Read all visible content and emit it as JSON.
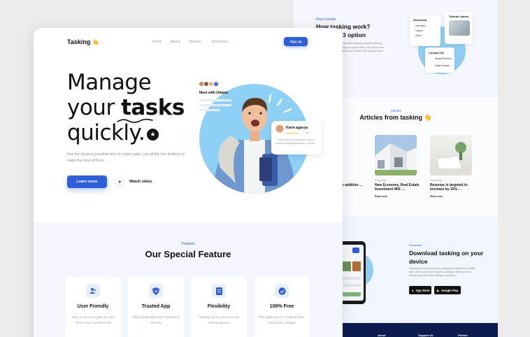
{
  "back_page": {
    "how": {
      "kicker": "How it works",
      "title_line1": "How tasking work?",
      "title_line2": "3 option",
      "text": "Use the simplest possible tasking app to create tasks, use all the free features to make the most of them"
    },
    "mini_cards": {
      "document": "Document",
      "tutorial_videos": "Tutorial videos",
      "contact": "Contact US",
      "doc_rows": [
        "Instruction",
        "Tutorial",
        "Guide"
      ],
      "contact_rows": [
        "Ronald Richards",
        "Esther Howard"
      ]
    },
    "articles": {
      "kicker": "Articles",
      "title": "Articles from tasking",
      "items": [
        {
          "category": "Productivity",
          "title": "…y's addition …",
          "read": "Read more"
        },
        {
          "category": "Productivity",
          "title": "New Economy, Real Estate Investment Will …",
          "read": "Read more"
        },
        {
          "category": "Productivity",
          "title": "Revenue is targeted to increase by 15% …",
          "read": "Read more"
        }
      ]
    },
    "download": {
      "kicker": "Download",
      "title": "Download tasking on your device",
      "text": "Tasking serves as your task management platform to finally have one to meet and forget to download Tasking to the devices you need and manage your tasks.",
      "app_store": "App Store",
      "google_play": "Google Play"
    },
    "footer": {
      "col1": "About",
      "col2": "Support Us",
      "col3": "Partner"
    }
  },
  "nav": {
    "logo": "Tasking",
    "logo_emoji": "👋",
    "links": [
      "Home",
      "About",
      "Member",
      "Enterprise"
    ],
    "enterprise_chevron": "⌄",
    "signup": "Sign Up"
  },
  "hero": {
    "line1": "Manage",
    "line2_a": "your ",
    "line2_b": "tasks",
    "line3": "quickly.",
    "star": "★",
    "description": "Use the simplest possible time to create tasks, use all the free features to make the most of them",
    "learn_more": "Learn more",
    "watch_video": "Watch video",
    "meet_title": "Meet with Odama",
    "meet_plus": "+",
    "review": {
      "name": "Karin agasya",
      "stars": "★★★★★",
      "score": "4.8",
      "text": "\" I think very good experience when using the tasking application. Thanks.\""
    }
  },
  "features": {
    "kicker": "Feature",
    "title": "Our Special Feature",
    "cards": [
      {
        "name": "User Friendly",
        "desc": "Easy to use for people who are either new or professional",
        "icon": "users-icon"
      },
      {
        "name": "Trusted App",
        "desc": "Official application that is trusted for security",
        "icon": "shield-icon"
      },
      {
        "name": "Flexibility",
        "desc": "Tasking can be opened on all existing devices",
        "icon": "document-icon"
      },
      {
        "name": "100% Free",
        "desc": "This application is completely free, without any charges",
        "icon": "badge-check-icon"
      }
    ]
  },
  "colors": {
    "accent": "#2f5fd8",
    "hero_circle": "#8fd0f6",
    "feature_bg": "#f3f6fd",
    "footer": "#0c1c4f"
  }
}
